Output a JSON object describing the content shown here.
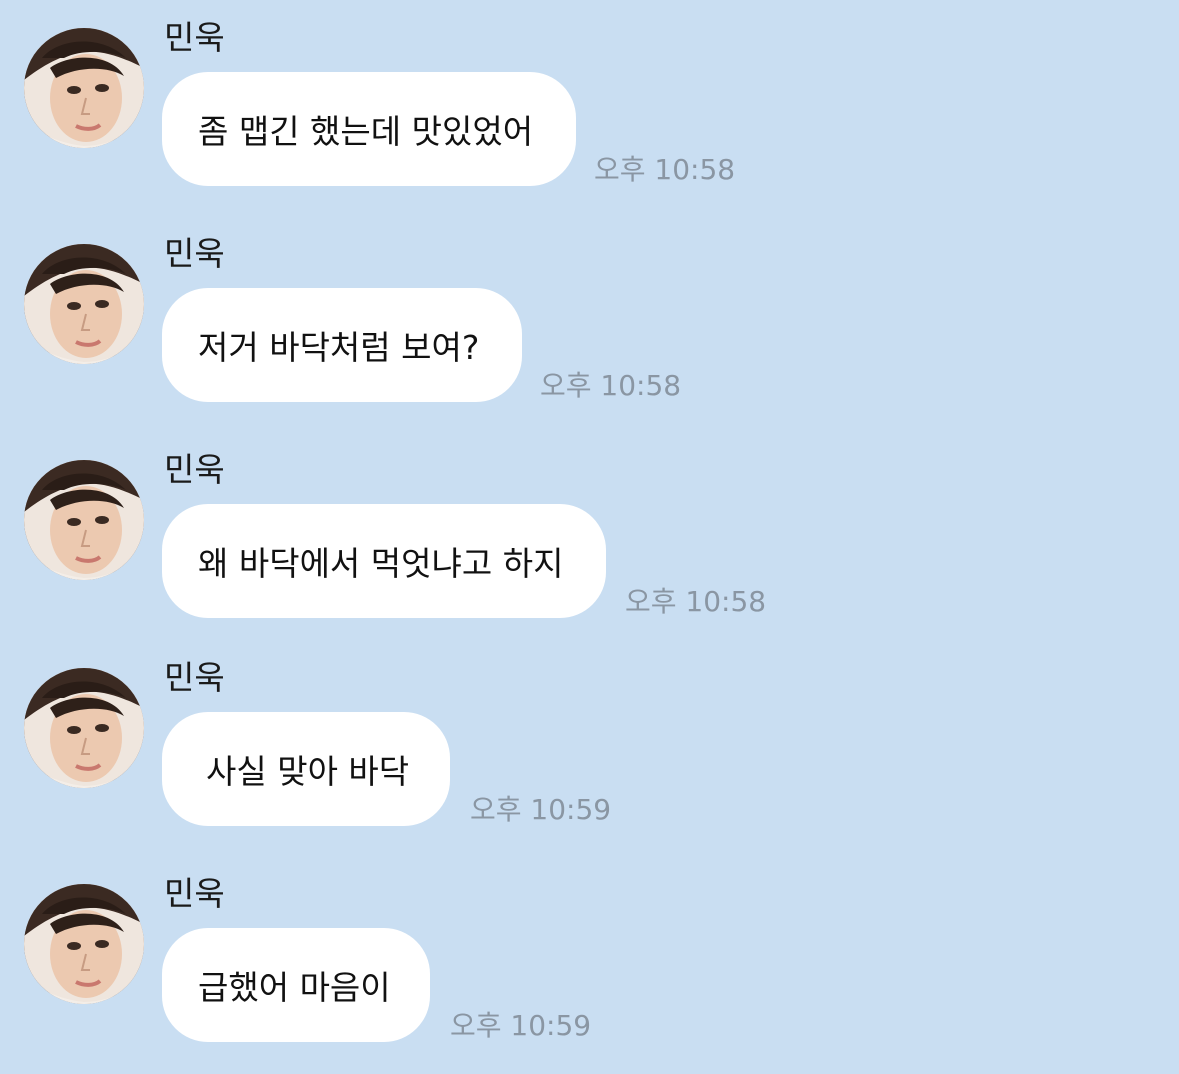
{
  "chat": {
    "messages": [
      {
        "sender": "민욱",
        "text": "좀 맵긴 했는데 맛있었어",
        "time": "오후 10:58"
      },
      {
        "sender": "민욱",
        "text": "저거 바닥처럼 보여?",
        "time": "오후 10:58"
      },
      {
        "sender": "민욱",
        "text": "왜 바닥에서 먹엇냐고 하지",
        "time": "오후 10:58"
      },
      {
        "sender": "민욱",
        "text": "사실 맞아 바닥",
        "time": "오후 10:59"
      },
      {
        "sender": "민욱",
        "text": "급했어 마음이",
        "time": "오후 10:59"
      }
    ]
  },
  "colors": {
    "background": "#c9def2",
    "bubble": "#ffffff",
    "timestamp": "#8a96a3"
  },
  "icons": {
    "avatar": "profile-photo-avatar"
  }
}
